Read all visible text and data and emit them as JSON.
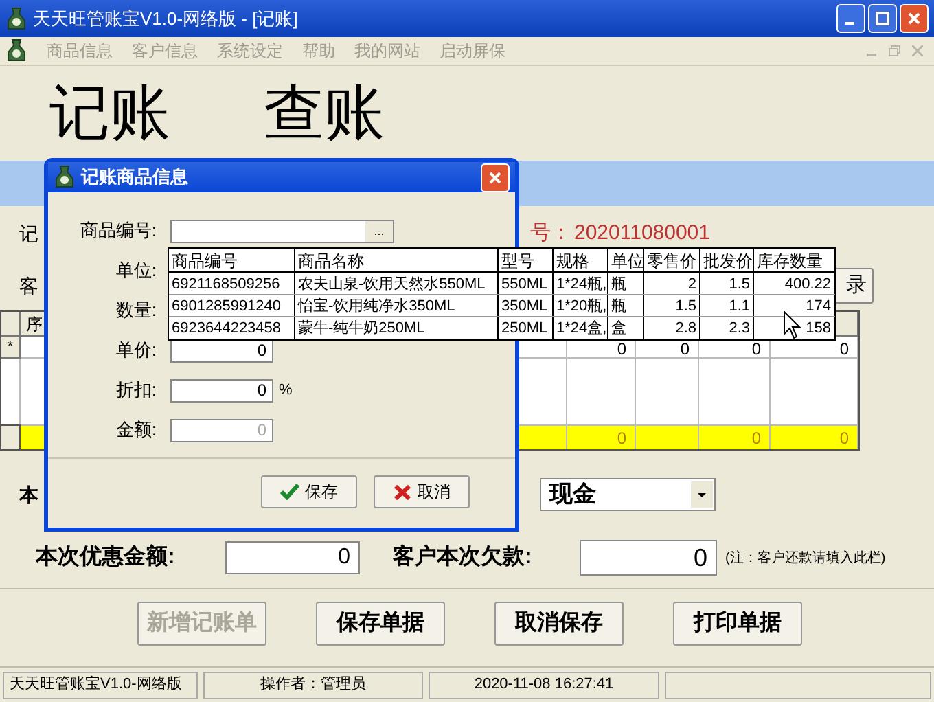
{
  "window": {
    "title": "天天旺管账宝V1.0-网络版 - [记账]"
  },
  "menu": [
    {
      "label": "商品信息",
      "disabled": true
    },
    {
      "label": "客户信息",
      "disabled": true
    },
    {
      "label": "系统设定",
      "disabled": true
    },
    {
      "label": "帮助",
      "disabled": true
    },
    {
      "label": "我的网站",
      "disabled": true
    },
    {
      "label": "启动屏保",
      "disabled": true
    }
  ],
  "mode_tabs": [
    "记账",
    "查账"
  ],
  "form": {
    "label_fragments": [
      "记",
      "客",
      "本"
    ],
    "order_no_label": "号：",
    "order_no": "202011080001",
    "record_button": "录",
    "payment_method": "现金",
    "discount_label": "本次优惠金额:",
    "discount_value": "0",
    "debt_label": "客户本次欠款:",
    "debt_value": "0",
    "debt_note": "(注：客户还款请填入此栏)"
  },
  "grid": {
    "first_column": "序",
    "new_row_marker": "*",
    "new_row": [
      "0",
      "0",
      "0",
      "0"
    ],
    "total_row": [
      {
        "kind": "value",
        "value": "0"
      },
      {
        "kind": "blank"
      },
      {
        "kind": "value",
        "value": "0"
      },
      {
        "kind": "value",
        "value": "0"
      }
    ]
  },
  "buttons": [
    {
      "label": "新增记账单",
      "disabled": true
    },
    {
      "label": "保存单据",
      "disabled": false
    },
    {
      "label": "取消保存",
      "disabled": false
    },
    {
      "label": "打印单据",
      "disabled": false
    }
  ],
  "status_bar": [
    "天天旺管账宝V1.0-网络版",
    "操作者：管理员",
    "2020-11-08 16:27:41"
  ],
  "dialog": {
    "title": "记账商品信息",
    "fields": [
      {
        "label": "商品编号:",
        "kind": "lookup",
        "lookup_button": "..."
      },
      {
        "label": "单位:",
        "kind": "covered"
      },
      {
        "label": "数量:",
        "kind": "covered"
      },
      {
        "label": "单价:",
        "kind": "number",
        "value": "0",
        "disabled": false
      },
      {
        "label": "折扣:",
        "kind": "number",
        "value": "0",
        "suffix": "%",
        "disabled": false
      },
      {
        "label": "金额:",
        "kind": "number",
        "value": "0",
        "disabled": true
      }
    ],
    "buttons": [
      {
        "label": "保存",
        "kind": "ok"
      },
      {
        "label": "取消",
        "kind": "cancel"
      }
    ]
  },
  "product_popup": {
    "columns": [
      "商品编号",
      "商品名称",
      "型号",
      "规格",
      "单位",
      "零售价",
      "批发价",
      "库存数量"
    ],
    "rows": [
      [
        "6921168509256",
        "农夫山泉-饮用天然水550ML",
        "550ML",
        "1*24瓶,",
        "瓶",
        "2",
        "1.5",
        "400.22"
      ],
      [
        "6901285991240",
        "怡宝-饮用纯净水350ML",
        "350ML",
        "1*20瓶,",
        "瓶",
        "1.5",
        "1.1",
        "174"
      ],
      [
        "6923644223458",
        "蒙牛-纯牛奶250ML",
        "250ML",
        "1*24盒,",
        "盒",
        "2.8",
        "2.3",
        "158"
      ]
    ]
  }
}
